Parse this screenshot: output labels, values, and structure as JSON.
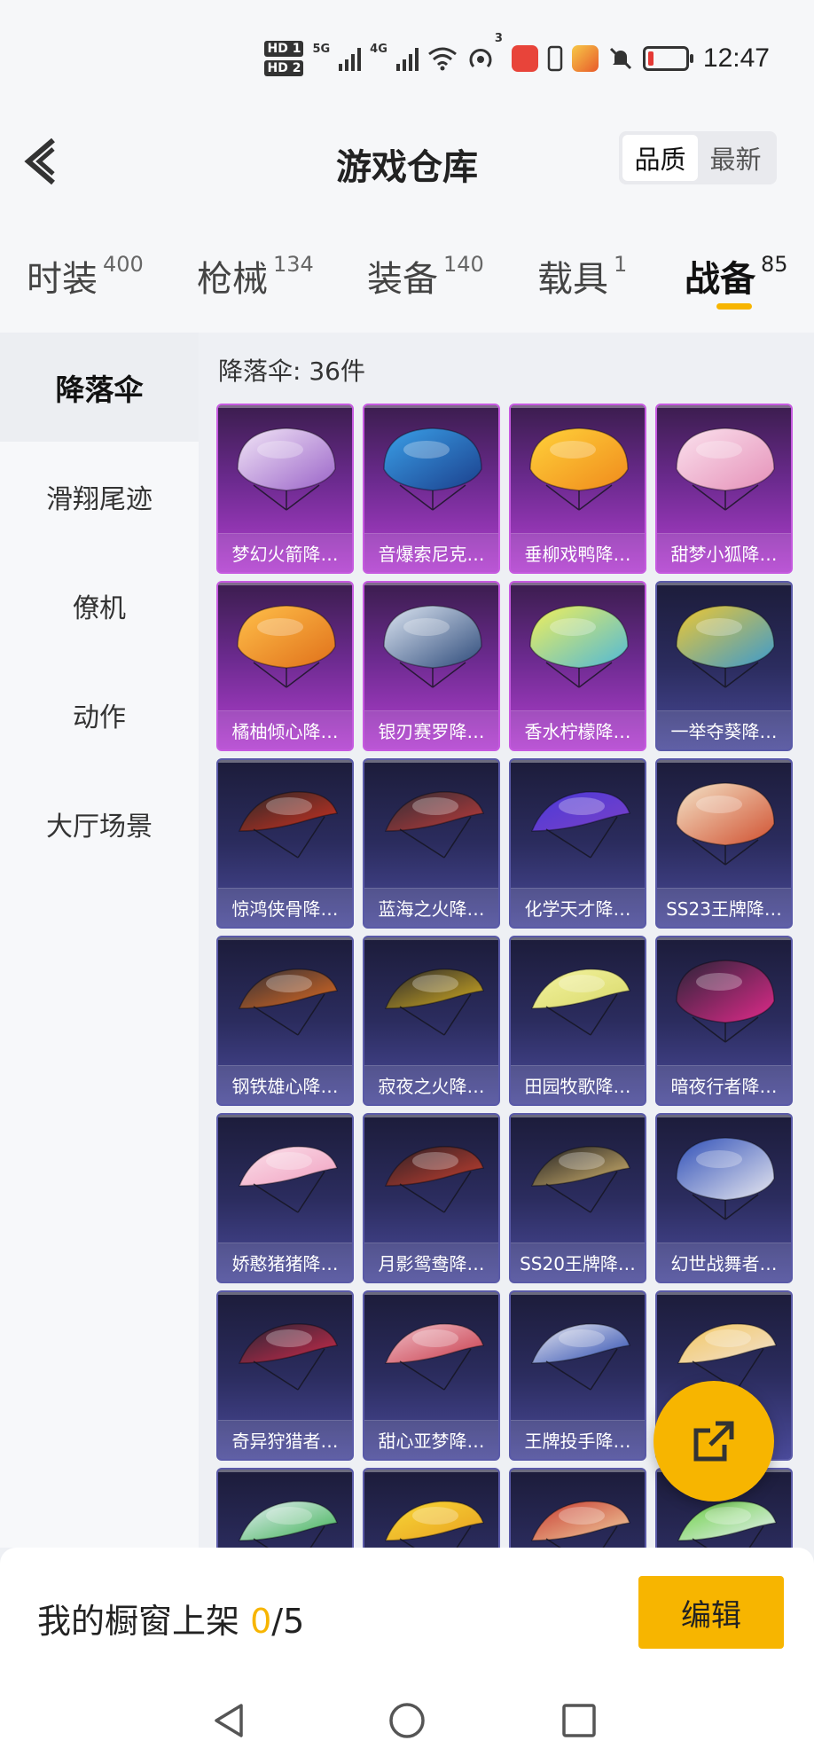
{
  "status_bar": {
    "hd1": "HD 1",
    "hd2": "HD 2",
    "net1": "5G",
    "net2": "4G",
    "hotspot_count": "3",
    "time": "12:47"
  },
  "header": {
    "title": "游戏仓库",
    "sort_options": [
      "品质",
      "最新"
    ],
    "active_sort": "品质"
  },
  "tabs": [
    {
      "label": "时装",
      "count": "400"
    },
    {
      "label": "枪械",
      "count": "134"
    },
    {
      "label": "装备",
      "count": "140"
    },
    {
      "label": "载具",
      "count": "1"
    },
    {
      "label": "战备",
      "count": "85"
    }
  ],
  "active_tab": "战备",
  "sidebar": {
    "items": [
      "降落伞",
      "滑翔尾迹",
      "僚机",
      "动作",
      "大厅场景"
    ],
    "active": "降落伞"
  },
  "content": {
    "count_label": "降落伞: 36件",
    "items": [
      {
        "name": "梦幻火箭降…",
        "rarity": "purple",
        "c1": "#f2e6f7",
        "c2": "#9a63c8"
      },
      {
        "name": "音爆索尼克…",
        "rarity": "purple",
        "c1": "#3aa0e8",
        "c2": "#1b3f8c"
      },
      {
        "name": "垂柳戏鸭降…",
        "rarity": "purple",
        "c1": "#ffd23a",
        "c2": "#f08a1c"
      },
      {
        "name": "甜梦小狐降…",
        "rarity": "purple",
        "c1": "#fbe2ee",
        "c2": "#e590b8"
      },
      {
        "name": "橘柚倾心降…",
        "rarity": "purple",
        "c1": "#ffc04a",
        "c2": "#e0701a"
      },
      {
        "name": "银刃赛罗降…",
        "rarity": "purple",
        "c1": "#dde6f2",
        "c2": "#2d4a7a"
      },
      {
        "name": "香水柠檬降…",
        "rarity": "purple",
        "c1": "#f2f05a",
        "c2": "#4fb8d8"
      },
      {
        "name": "一举夺葵降…",
        "rarity": "blue",
        "c1": "#f0c830",
        "c2": "#3a9ad0"
      },
      {
        "name": "惊鸿侠骨降…",
        "rarity": "blue",
        "c1": "#2a2a2a",
        "c2": "#d03020"
      },
      {
        "name": "蓝海之火降…",
        "rarity": "blue",
        "c1": "#2e2e36",
        "c2": "#c03a3a"
      },
      {
        "name": "化学天才降…",
        "rarity": "blue",
        "c1": "#4a3ad8",
        "c2": "#7a40c8"
      },
      {
        "name": "SS23王牌降…",
        "rarity": "blue",
        "c1": "#f4e4c8",
        "c2": "#d05030"
      },
      {
        "name": "钢铁雄心降…",
        "rarity": "blue",
        "c1": "#303038",
        "c2": "#e06a20"
      },
      {
        "name": "寂夜之火降…",
        "rarity": "blue",
        "c1": "#26262e",
        "c2": "#d8b020"
      },
      {
        "name": "田园牧歌降…",
        "rarity": "blue",
        "c1": "#f4f4a0",
        "c2": "#d8d86a"
      },
      {
        "name": "暗夜行者降…",
        "rarity": "blue",
        "c1": "#2a2438",
        "c2": "#e02a8a"
      },
      {
        "name": "娇憨猪猪降…",
        "rarity": "blue",
        "c1": "#fbe0ea",
        "c2": "#f0a0c0"
      },
      {
        "name": "月影鸳鸯降…",
        "rarity": "blue",
        "c1": "#2a2026",
        "c2": "#c84030"
      },
      {
        "name": "SS20王牌降…",
        "rarity": "blue",
        "c1": "#1e1e22",
        "c2": "#d8b870"
      },
      {
        "name": "幻世战舞者…",
        "rarity": "blue",
        "c1": "#3050b8",
        "c2": "#e8e8f0"
      },
      {
        "name": "奇异狩猎者…",
        "rarity": "blue",
        "c1": "#262636",
        "c2": "#d02a4a"
      },
      {
        "name": "甜心亚梦降…",
        "rarity": "blue",
        "c1": "#f0c0c8",
        "c2": "#c83a4a"
      },
      {
        "name": "王牌投手降…",
        "rarity": "blue",
        "c1": "#e8e8f0",
        "c2": "#2a4ab0"
      },
      {
        "name": "",
        "rarity": "blue",
        "c1": "#f4c860",
        "c2": "#f0e0d0"
      },
      {
        "name": "",
        "rarity": "blue",
        "c1": "#e8f0f8",
        "c2": "#3ab050"
      },
      {
        "name": "",
        "rarity": "blue",
        "c1": "#f8d838",
        "c2": "#e8a020"
      },
      {
        "name": "",
        "rarity": "blue",
        "c1": "#c83a30",
        "c2": "#f0d0a0"
      },
      {
        "name": "",
        "rarity": "blue",
        "c1": "#6ad040",
        "c2": "#e8f0f8"
      }
    ]
  },
  "bottom": {
    "showcase_prefix": "我的橱窗上架 ",
    "showcase_current": "0",
    "showcase_total": "/5",
    "edit_label": "编辑"
  },
  "colors": {
    "accent": "#f7b500",
    "legendary": "#b23fd0",
    "epic": "#4a4a9a"
  }
}
